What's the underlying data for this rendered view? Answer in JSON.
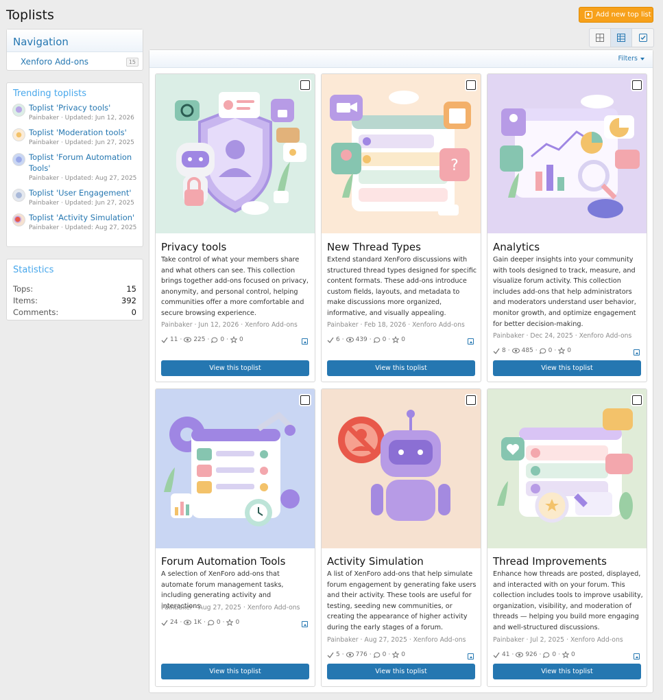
{
  "page": {
    "title": "Toplists",
    "add_button": "Add new top list"
  },
  "navigation": {
    "heading": "Navigation",
    "item_label": "Xenforo Add-ons",
    "item_count": "15"
  },
  "trending": {
    "heading": "Trending toplists",
    "items": [
      {
        "title": "Toplist 'Privacy tools'",
        "meta": "Painbaker · Updated: Jun 12, 2026"
      },
      {
        "title": "Toplist 'Moderation tools'",
        "meta": "Painbaker · Updated: Jun 27, 2025"
      },
      {
        "title": "Toplist 'Forum Automation Tools'",
        "meta": "Painbaker · Updated: Aug 27, 2025"
      },
      {
        "title": "Toplist 'User Engagement'",
        "meta": "Painbaker · Updated: Jun 27, 2025"
      },
      {
        "title": "Toplist 'Activity Simulation'",
        "meta": "Painbaker · Updated: Aug 27, 2025"
      }
    ]
  },
  "statistics": {
    "heading": "Statistics",
    "rows": [
      {
        "label": "Tops:",
        "value": "15"
      },
      {
        "label": "Items:",
        "value": "392"
      },
      {
        "label": "Comments:",
        "value": "0"
      }
    ]
  },
  "main": {
    "filters_label": "Filters"
  },
  "cards": [
    {
      "title": "Privacy tools",
      "description": "Take control of what your members share and what others can see. This collection brings together add-ons focused on privacy, anonymity, and personal control, helping communities offer a more comfortable and secure browsing experience.",
      "author": "Painbaker · Jun 12, 2026 · Xenforo Add-ons",
      "items": "11",
      "views": "225",
      "comments": "0",
      "rating": "0",
      "button": "View this toplist",
      "bg": "#dbeee6",
      "theme": "privacy"
    },
    {
      "title": "New Thread Types",
      "description": "Extend standard XenForo discussions with structured thread types designed for specific content formats. These add-ons introduce custom fields, layouts, and metadata to make discussions more organized, informative, and visually appealing.",
      "author": "Painbaker · Feb 18, 2026 · Xenforo Add-ons",
      "items": "6",
      "views": "439",
      "comments": "0",
      "rating": "0",
      "button": "View this toplist",
      "bg": "#fce9d6",
      "theme": "thread"
    },
    {
      "title": "Analytics",
      "description": "Gain deeper insights into your community with tools designed to track, measure, and visualize forum activity. This collection includes add-ons that help administrators and moderators understand user behavior, monitor growth, and optimize engagement for better decision-making.",
      "author": "Painbaker · Dec 24, 2025 · Xenforo Add-ons",
      "items": "8",
      "views": "485",
      "comments": "0",
      "rating": "0",
      "button": "View this toplist",
      "bg": "#e1d6f3",
      "theme": "analytics"
    },
    {
      "title": "Forum Automation Tools",
      "description": "A selection of XenForo add-ons that automate forum management tasks, including generating activity and interactions.",
      "author": "Painbaker · Aug 27, 2025 · Xenforo Add-ons",
      "items": "24",
      "views": "1K",
      "comments": "0",
      "rating": "0",
      "button": "View this toplist",
      "bg": "#c9d6f3",
      "theme": "automation"
    },
    {
      "title": "Activity Simulation",
      "description": "A list of XenForo add-ons that help simulate forum engagement by generating fake users and their activity. These tools are useful for testing, seeding new communities, or creating the appearance of higher activity during the early stages of a forum.",
      "author": "Painbaker · Aug 27, 2025 · Xenforo Add-ons",
      "items": "5",
      "views": "776",
      "comments": "0",
      "rating": "0",
      "button": "View this toplist",
      "bg": "#f6e1d0",
      "theme": "simulation"
    },
    {
      "title": "Thread Improvements",
      "description": "Enhance how threads are posted, displayed, and interacted with on your forum. This collection includes tools to improve usability, organization, visibility, and moderation of threads — helping you build more engaging and well-structured discussions.",
      "author": "Painbaker · Jul 2, 2025 · Xenforo Add-ons",
      "items": "41",
      "views": "926",
      "comments": "0",
      "rating": "0",
      "button": "View this toplist",
      "bg": "#e0ecd8",
      "theme": "improve"
    }
  ]
}
